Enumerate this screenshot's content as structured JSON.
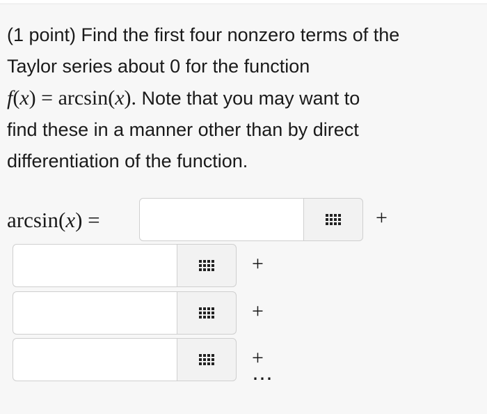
{
  "problem": {
    "line1": "(1 point) Find the first four nonzero terms of the",
    "line2": "Taylor series about 0 for the function",
    "func_f": "f",
    "func_x": "x",
    "func_eq": " = arcsin(",
    "func_x2": "x",
    "func_close": ").",
    "line3_rest": " Note that you may want to",
    "line4": "find these in a manner other than by direct",
    "line5": "differentiation of the function."
  },
  "answer": {
    "lhs_fn": "arcsin(",
    "lhs_x": "x",
    "lhs_close": ") =",
    "fields": [
      {
        "value": "",
        "plus": "+"
      },
      {
        "value": "",
        "plus": "+"
      },
      {
        "value": "",
        "plus": "+"
      },
      {
        "value": "",
        "plus": "+ ⋯"
      }
    ],
    "palette_icon": "equation-editor-grid-icon"
  }
}
